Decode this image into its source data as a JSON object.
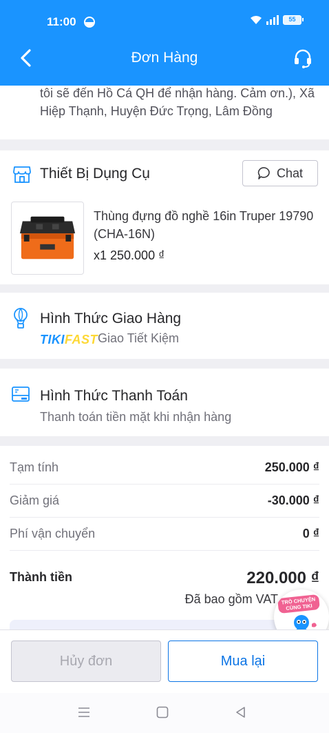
{
  "status_bar": {
    "time": "11:00",
    "battery": "55"
  },
  "header": {
    "title": "Đơn Hàng"
  },
  "address": {
    "partial_text": "tôi sẽ đến Hồ Cá QH để nhận hàng. Cảm ơn.), Xã Hiệp Thạnh, Huyện Đức Trọng, Lâm Đồng"
  },
  "shop": {
    "name": "Thiết Bị Dụng Cụ",
    "chat_label": "Chat",
    "product": {
      "name": "Thùng đựng đồ nghề 16in Truper 19790 (CHA-16N)",
      "qty_price": "x1  250.000 ₫"
    }
  },
  "shipping": {
    "title": "Hình Thức Giao Hàng",
    "brand_tiki": "TIKI",
    "brand_fast": "FAST",
    "method": "Giao Tiết Kiệm"
  },
  "payment": {
    "title": "Hình Thức Thanh Toán",
    "method": "Thanh toán tiền mặt khi nhận hàng"
  },
  "summary": {
    "rows": [
      {
        "label": "Tạm tính",
        "value": "250.000 ₫"
      },
      {
        "label": "Giảm giá",
        "value": "-30.000 ₫"
      },
      {
        "label": "Phí vận chuyển",
        "value": "0 ₫"
      }
    ],
    "total_label": "Thành tiền",
    "total_value": "220.000 ₫",
    "vat_note": "Đã bao gồm VAT"
  },
  "chat_bubble": {
    "label": "TRÒ CHUYỆN CÙNG TIKI"
  },
  "actions": {
    "cancel_label": "Hủy đơn",
    "rebuy_label": "Mua lại"
  },
  "colors": {
    "primary": "#1a94ff",
    "button_blue": "#0b74e5",
    "fast_yellow": "#fdd835"
  }
}
